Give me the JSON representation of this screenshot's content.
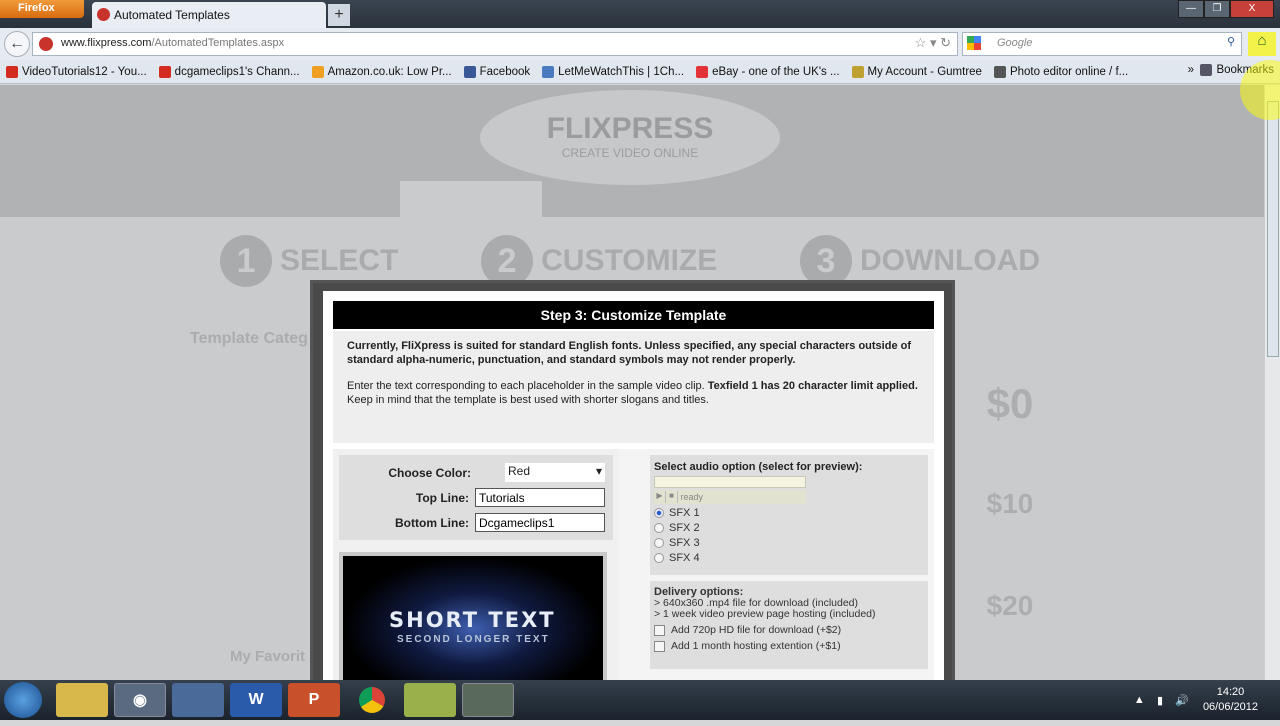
{
  "browser": {
    "menu": "Firefox",
    "tab_title": "Automated Templates",
    "url_domain": "www.flixpress.com",
    "url_path": "/AutomatedTemplates.aspx",
    "search_placeholder": "Google",
    "bookmarks": [
      {
        "label": "VideoTutorials12 - You...",
        "icon": "youtube-icon",
        "color": "#d32c1e"
      },
      {
        "label": "dcgameclips1's Chann...",
        "icon": "youtube-icon",
        "color": "#d32c1e"
      },
      {
        "label": "Amazon.co.uk: Low Pr...",
        "icon": "amazon-icon",
        "color": "#f0a020"
      },
      {
        "label": "Facebook",
        "icon": "facebook-icon",
        "color": "#3b5998"
      },
      {
        "label": "LetMeWatchThis | 1Ch...",
        "icon": "letmewatchthis-icon",
        "color": "#4a7ac0"
      },
      {
        "label": "eBay - one of the UK's ...",
        "icon": "ebay-icon",
        "color": "#e53238"
      },
      {
        "label": "My Account - Gumtree",
        "icon": "gumtree-icon",
        "color": "#c0a030"
      },
      {
        "label": "Photo editor online / f...",
        "icon": "pencil-icon",
        "color": "#555555"
      }
    ],
    "bookmarks_menu": "Bookmarks"
  },
  "background_page": {
    "logo": "FLIXPRESS",
    "tagline": "CREATE VIDEO ONLINE",
    "steps": [
      {
        "num": "1",
        "label": "SELECT"
      },
      {
        "num": "2",
        "label": "CUSTOMIZE"
      },
      {
        "num": "3",
        "label": "DOWNLOAD"
      }
    ],
    "left_heading": "Template Categ",
    "favorites_heading": "My Favorit",
    "balances": [
      "$0",
      "$10",
      "$20"
    ]
  },
  "modal": {
    "title": "Step 3: Customize Template",
    "notice": "Currently, FliXpress is suited for standard English fonts. Unless specified, any special characters outside of standard alpha-numeric, punctuation, and standard symbols may not render properly.",
    "instructions": "Enter the text corresponding to each placeholder in the sample video clip.",
    "instructions_bold": "Texfield 1 has 20 character limit applied.",
    "instructions_tail": "Keep in mind that the template is best used with shorter slogans and titles.",
    "form": {
      "color_label": "Choose Color:",
      "color_value": "Red",
      "top_label": "Top Line:",
      "top_value": "Tutorials",
      "bottom_label": "Bottom Line:",
      "bottom_value": "Dcgameclips1"
    },
    "preview": {
      "line1": "SHORT TEXT",
      "line2": "SECOND LONGER TEXT"
    },
    "audio": {
      "heading": "Select audio option (select for preview):",
      "status": "ready",
      "options": [
        "SFX 1",
        "SFX 2",
        "SFX 3",
        "SFX 4"
      ],
      "selected": "SFX 1"
    },
    "delivery": {
      "heading": "Delivery options:",
      "lines": [
        "> 640x360 .mp4 file for download (included)",
        "> 1 week video preview page hosting (included)"
      ],
      "addons": [
        "Add 720p HD file for download (+$2)",
        "Add 1 month hosting extention (+$1)"
      ]
    }
  },
  "taskbar": {
    "time": "14:20",
    "date": "06/06/2012"
  }
}
